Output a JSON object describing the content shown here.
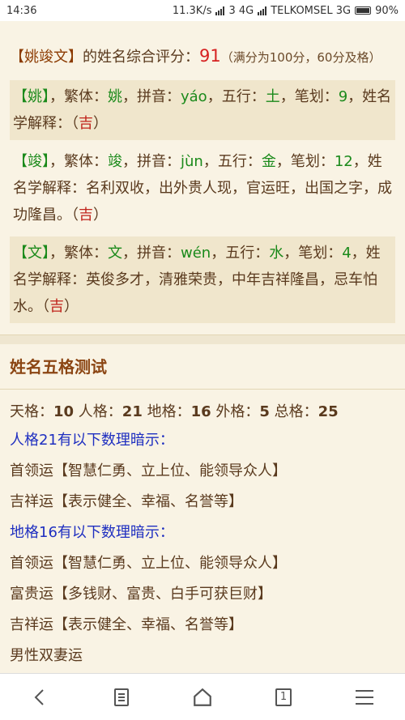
{
  "status": {
    "time": "14:36",
    "speed": "11.3K/s",
    "network": "3 4G",
    "carrier": "TELKOMSEL 3G",
    "battery": "90%"
  },
  "summary": {
    "name": "【姚竣文】",
    "text": "的姓名综合评分：",
    "score": "91",
    "note": "（满分为100分，60分及格）"
  },
  "chars": [
    {
      "char": "【姚】",
      "trad_label": "，繁体：",
      "trad": "姚",
      "pinyin_label": "，拼音：",
      "pinyin": "yáo",
      "wuxing_label": "，五行：",
      "wuxing": "土",
      "strokes_label": "，笔划：",
      "strokes": "9",
      "end": "，",
      "explain_label": "姓名学解释：（",
      "explain": "",
      "luck": "吉",
      "close": "）"
    },
    {
      "char": "【竣】",
      "trad_label": "，繁体：",
      "trad": "竣",
      "pinyin_label": "，拼音：",
      "pinyin": "jùn",
      "wuxing_label": "，五行：",
      "wuxing": "金",
      "strokes_label": "，笔划：",
      "strokes": "12",
      "end": "，",
      "explain_label": "姓名学解释：",
      "explain": "名利双收，出外贵人现，官运旺，出国之字，成功隆昌。（",
      "luck": "吉",
      "close": "）"
    },
    {
      "char": "【文】",
      "trad_label": "，繁体：",
      "trad": "文",
      "pinyin_label": "，拼音：",
      "pinyin": "wén",
      "wuxing_label": "，五行：",
      "wuxing": "水",
      "strokes_label": "，笔划：",
      "strokes": "4",
      "end": "，",
      "explain_label": "姓名学解释：",
      "explain": "英俊多才，清雅荣贵，中年吉祥隆昌，忌车怕水。（",
      "luck": "吉",
      "close": "）"
    }
  ],
  "section": {
    "title": "姓名五格测试"
  },
  "grids": {
    "tian_label": "天格：",
    "tian": "10",
    "ren_label": " 人格：",
    "ren": "21",
    "di_label": " 地格：",
    "di": "16",
    "wai_label": " 外格：",
    "wai": "5",
    "zong_label": " 总格：",
    "zong": "25"
  },
  "hints": [
    {
      "text": "人格21有以下数理暗示：",
      "style": "blue"
    },
    {
      "text": "首领运【智慧仁勇、立上位、能领导众人】",
      "style": "normal"
    },
    {
      "text": "吉祥运【表示健全、幸福、名誉等】",
      "style": "normal"
    },
    {
      "text": "地格16有以下数理暗示：",
      "style": "blue"
    },
    {
      "text": "首领运【智慧仁勇、立上位、能领导众人】",
      "style": "normal"
    },
    {
      "text": "富贵运【多钱财、富贵、白手可获巨财】",
      "style": "normal"
    },
    {
      "text": "吉祥运【表示健全、幸福、名誉等】",
      "style": "normal"
    },
    {
      "text": "男性双妻运",
      "style": "normal"
    }
  ],
  "nav": {
    "icons": [
      "back-icon",
      "menu-page-icon",
      "home-icon",
      "tabs-count-icon",
      "hamburger-icon"
    ],
    "tab_count": "1"
  }
}
